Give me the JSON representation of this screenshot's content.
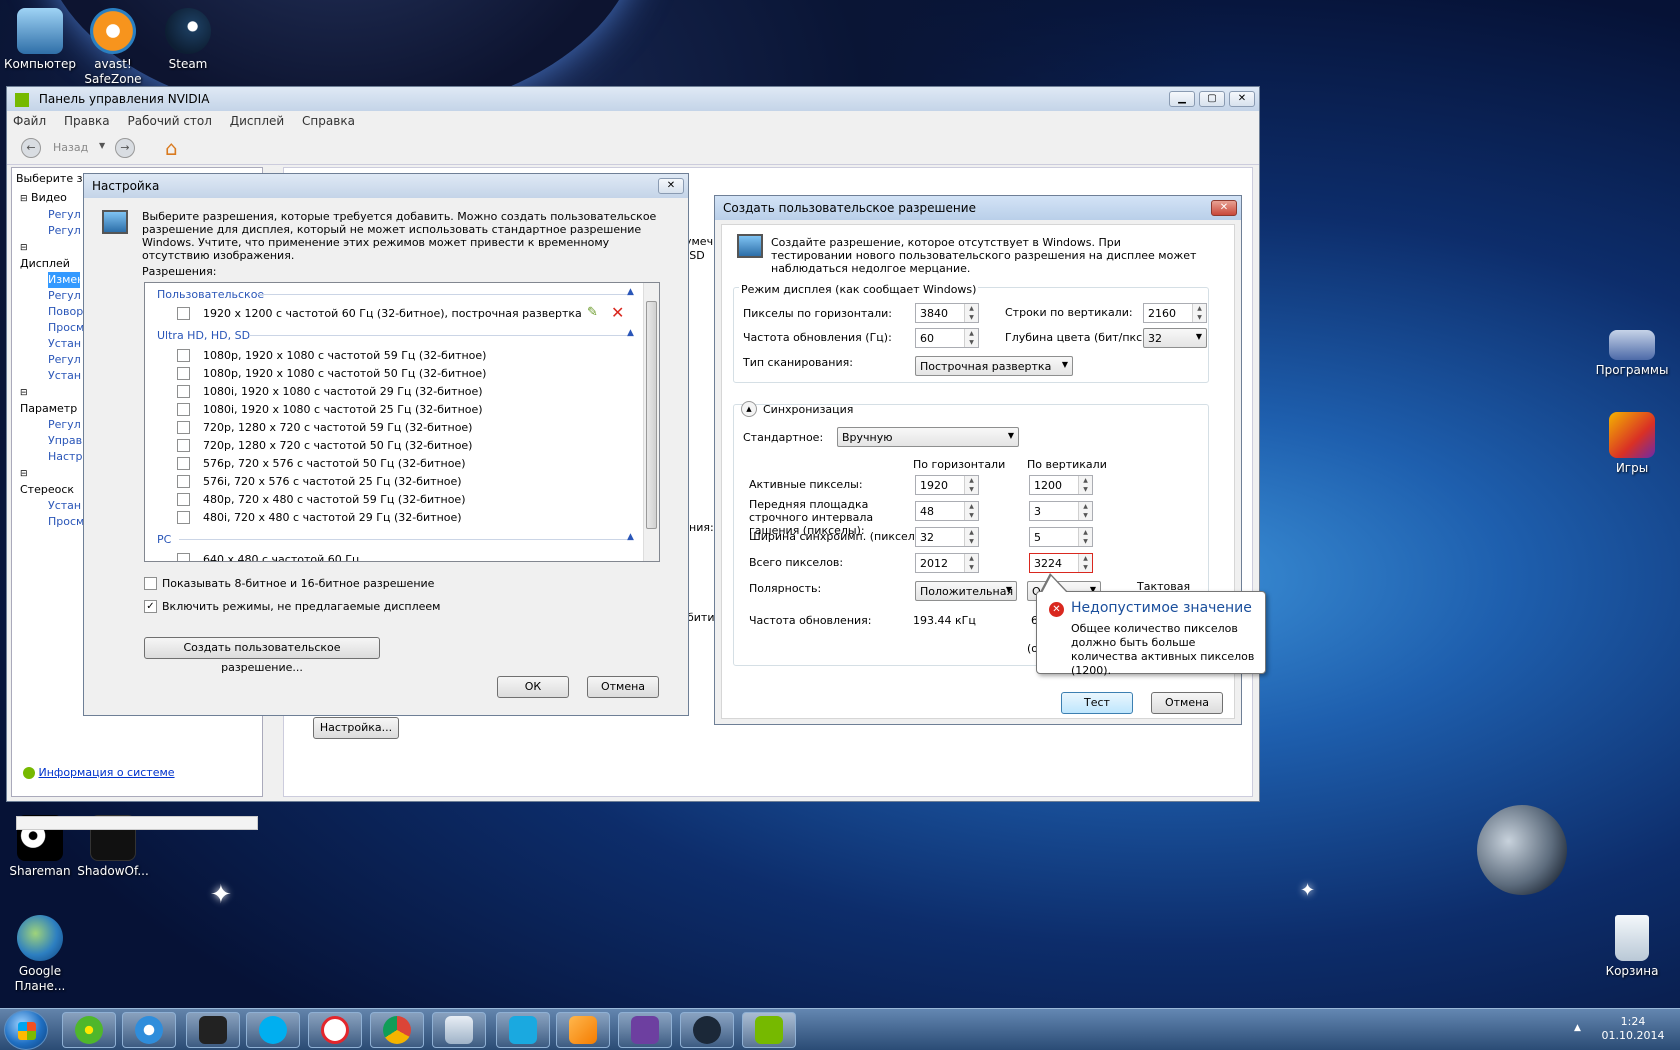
{
  "desktop": {
    "icons_top": [
      {
        "label": "Компьютер"
      },
      {
        "label": "avast! SafeZone"
      },
      {
        "label": "Steam"
      }
    ],
    "icons_right": [
      {
        "label": "Программы"
      },
      {
        "label": "Игры"
      },
      {
        "label": "Корзина"
      }
    ],
    "icons_bottom": [
      {
        "label": "Shareman"
      },
      {
        "label": "ShadowOf..."
      },
      {
        "label": "Google Плане..."
      }
    ]
  },
  "nvidia": {
    "title": "Панель управления NVIDIA",
    "menu": [
      "Файл",
      "Правка",
      "Рабочий стол",
      "Дисплей",
      "Справка"
    ],
    "back_label": "Назад",
    "task_header": "Выберите зад",
    "tree": [
      "Видео",
      "Регул",
      "Регул",
      "Дисплей",
      "Измен",
      "Регул",
      "Повор",
      "Просм",
      "Устан",
      "Регул",
      "Устан",
      "Параметр",
      "Регул",
      "Управ",
      "Настр",
      "Стереоск",
      "Устан",
      "Просм"
    ],
    "system_info": "Информация о системе",
    "settings_button": "Настройка...",
    "partial_texts": [
      "умеч",
      "(SD",
      "ния:",
      "бити"
    ]
  },
  "settings_dialog": {
    "title": "Настройка",
    "description": "Выберите разрешения, которые требуется добавить. Можно создать пользовательское разрешение для дисплея, который не может использовать стандартное разрешение Windows. Учтите, что применение этих режимов может привести к временному отсутствию изображения.",
    "list_label": "Разрешения:",
    "group_custom": "Пользовательское",
    "custom_item": "1920 x 1200 с частотой 60 Гц (32-битное), построчная развертка",
    "group_uhd": "Ultra HD, HD, SD",
    "uhd_items": [
      "1080p, 1920 x 1080 с частотой 59 Гц (32-битное)",
      "1080p, 1920 x 1080 с частотой 50 Гц (32-битное)",
      "1080i, 1920 x 1080 с частотой 29 Гц (32-битное)",
      "1080i, 1920 x 1080 с частотой 25 Гц (32-битное)",
      "720p, 1280 x 720 с частотой 59 Гц (32-битное)",
      "720p, 1280 x 720 с частотой 50 Гц (32-битное)",
      "576p, 720 x 576 с частотой 50 Гц (32-битное)",
      "576i, 720 x 576 с частотой 25 Гц (32-битное)",
      "480p, 720 x 480 с частотой 59 Гц (32-битное)",
      "480i, 720 x 480 с частотой 29 Гц (32-битное)"
    ],
    "group_pc": "PC",
    "pc_item_partial": "640 x 480 с частотой 60 Гц",
    "check_8bit": "Показывать 8-битное и 16-битное разрешение",
    "check_modes": "Включить режимы, не предлагаемые дисплеем",
    "create_button": "Создать пользовательское разрешение...",
    "ok_button": "ОК",
    "cancel_button": "Отмена"
  },
  "custom_dialog": {
    "title": "Создать пользовательское разрешение",
    "description": "Создайте разрешение, которое отсутствует в Windows. При тестировании нового пользовательского разрешения на дисплее может наблюдаться недолгое мерцание.",
    "mode_group": "Режим дисплея (как сообщает Windows)",
    "h_pixels_label": "Пикселы по горизонтали:",
    "h_pixels": "3840",
    "v_lines_label": "Строки по вертикали:",
    "v_lines": "2160",
    "refresh_label": "Частота обновления (Гц):",
    "refresh": "60",
    "depth_label": "Глубина цвета (бит/пкс):",
    "depth": "32",
    "scan_label": "Тип сканирования:",
    "scan": "Построчная развертка",
    "sync_label": "Синхронизация",
    "standard_label": "Стандартное:",
    "standard": "Вручную",
    "col_h": "По горизонтали",
    "col_v": "По вертикали",
    "active_label": "Активные пикселы:",
    "active_h": "1920",
    "active_v": "1200",
    "front_label": "Передняя площадка строчного интервала гашения (пикселы):",
    "front_h": "48",
    "front_v": "3",
    "sync_width_label": "Ширина синхроимп. (пикселы):",
    "sync_h": "32",
    "sync_v": "5",
    "total_label": "Всего пикселов:",
    "total_h": "2012",
    "total_v": "3224",
    "polarity_label": "Полярность:",
    "polarity_h": "Положительная",
    "polarity_v_partial": "О",
    "clock_partial": "Тактовая",
    "refresh_rate_label": "Частота обновления:",
    "refresh_rate": "193.44 кГц",
    "partial_6": "6",
    "partial_o": "(о",
    "test_button": "Тест",
    "cancel_button": "Отмена"
  },
  "error_tip": {
    "title": "Недопустимое значение",
    "message": "Общее количество пикселов должно быть больше количества активных пикселов (1200)."
  },
  "taskbar": {
    "time": "1:24",
    "date": "01.10.2014"
  }
}
